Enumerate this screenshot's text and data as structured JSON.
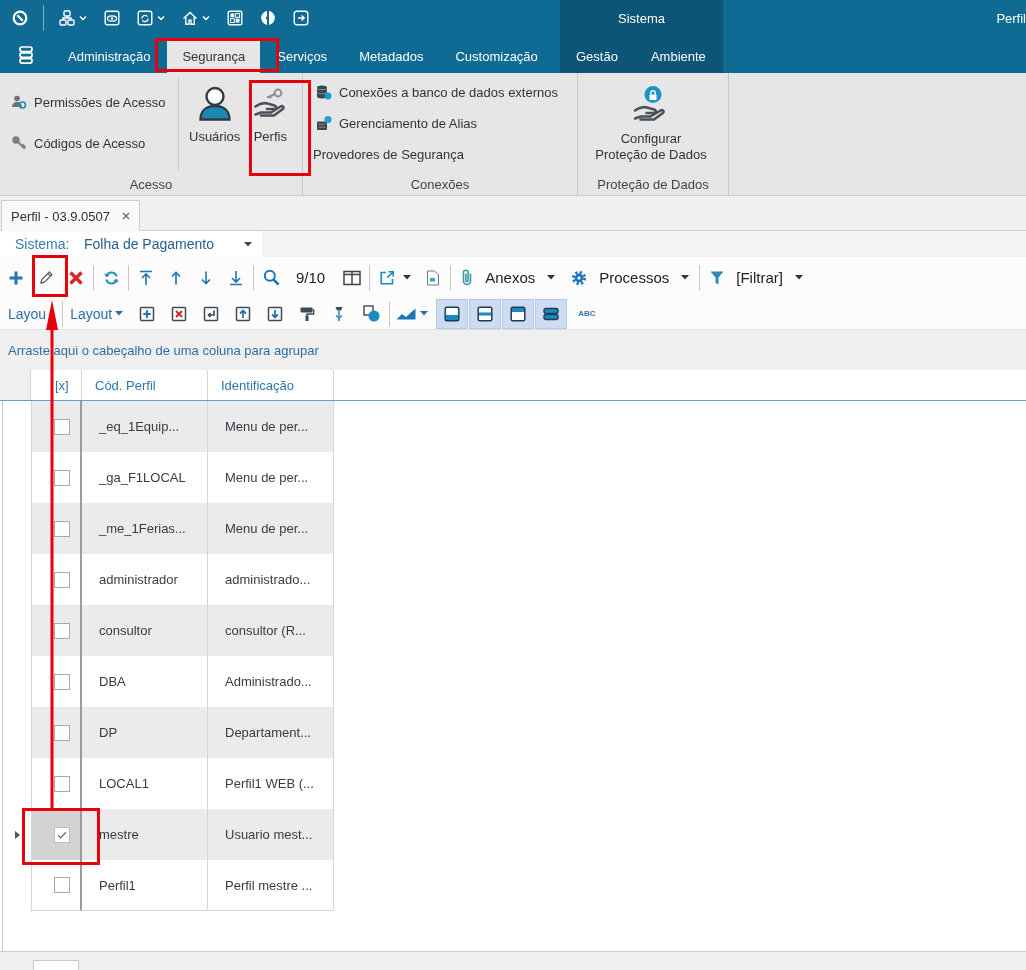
{
  "title_bar": {
    "document_title": "Perfil"
  },
  "ribbon": {
    "tabs": [
      {
        "label": "Administração",
        "selected": false
      },
      {
        "label": "Segurança",
        "selected": true
      },
      {
        "label": "Serviços",
        "selected": false
      },
      {
        "label": "Metadados",
        "selected": false
      },
      {
        "label": "Customização",
        "selected": false
      }
    ],
    "context_group": {
      "label": "Sistema",
      "tabs": [
        {
          "label": "Gestão",
          "selected": false
        },
        {
          "label": "Ambiente",
          "selected": false
        }
      ]
    },
    "groups": [
      {
        "label": "Acesso",
        "items": [
          {
            "kind": "small",
            "label": "Permissões de Acesso"
          },
          {
            "kind": "small",
            "label": "Códigos de Acesso"
          },
          {
            "kind": "large",
            "label": "Usuários"
          },
          {
            "kind": "large",
            "label": "Perfis"
          }
        ]
      },
      {
        "label": "Conexões",
        "items": [
          {
            "kind": "small",
            "label": "Conexões a banco de dados externos"
          },
          {
            "kind": "small",
            "label": "Gerenciamento de Alias"
          },
          {
            "kind": "plain",
            "label": "Provedores de Segurança"
          }
        ]
      },
      {
        "label": "Proteção de Dados",
        "items": [
          {
            "kind": "large",
            "label": "Configurar\nProteção de Dados"
          }
        ]
      }
    ]
  },
  "document_tabs": [
    {
      "label": "Perfil - 03.9.0507",
      "selected": true
    }
  ],
  "system_filter": {
    "label": "Sistema:",
    "value": "Folha de Pagamento"
  },
  "toolbar": {
    "record_counter": "9/10",
    "attachments": "Anexos",
    "processes": "Processos",
    "filter": "[Filtrar]"
  },
  "layout_toolbar": {
    "layout_label": "Layou",
    "layout_menu": "Layout",
    "view_toggles": [
      {
        "pressed": true
      },
      {
        "pressed": true
      },
      {
        "pressed": true
      },
      {
        "pressed": true
      }
    ],
    "spell_check": "ABC"
  },
  "grid": {
    "group_panel_hint": "Arraste aqui o cabeçalho de uma coluna para agrupar",
    "columns": [
      "[x]",
      "Cód. Perfil",
      "Identificação"
    ],
    "rows": [
      {
        "checked": false,
        "selected": false,
        "code": "_eq_1Equip...",
        "identification": "Menu de per..."
      },
      {
        "checked": false,
        "selected": false,
        "code": "_ga_F1LOCAL",
        "identification": "Menu de per..."
      },
      {
        "checked": false,
        "selected": false,
        "code": "_me_1Ferias...",
        "identification": "Menu de per..."
      },
      {
        "checked": false,
        "selected": false,
        "code": "administrador",
        "identification": "administrado..."
      },
      {
        "checked": false,
        "selected": false,
        "code": "consultor",
        "identification": "consultor (R..."
      },
      {
        "checked": false,
        "selected": false,
        "code": "DBA",
        "identification": "Administrado..."
      },
      {
        "checked": false,
        "selected": false,
        "code": "DP",
        "identification": "Departament..."
      },
      {
        "checked": false,
        "selected": false,
        "code": "LOCAL1",
        "identification": "Perfil1 WEB (..."
      },
      {
        "checked": true,
        "selected": true,
        "code": "mestre",
        "identification": "Usuario mest..."
      },
      {
        "checked": false,
        "selected": false,
        "code": "Perfil1",
        "identification": "Perfil mestre ..."
      }
    ]
  }
}
